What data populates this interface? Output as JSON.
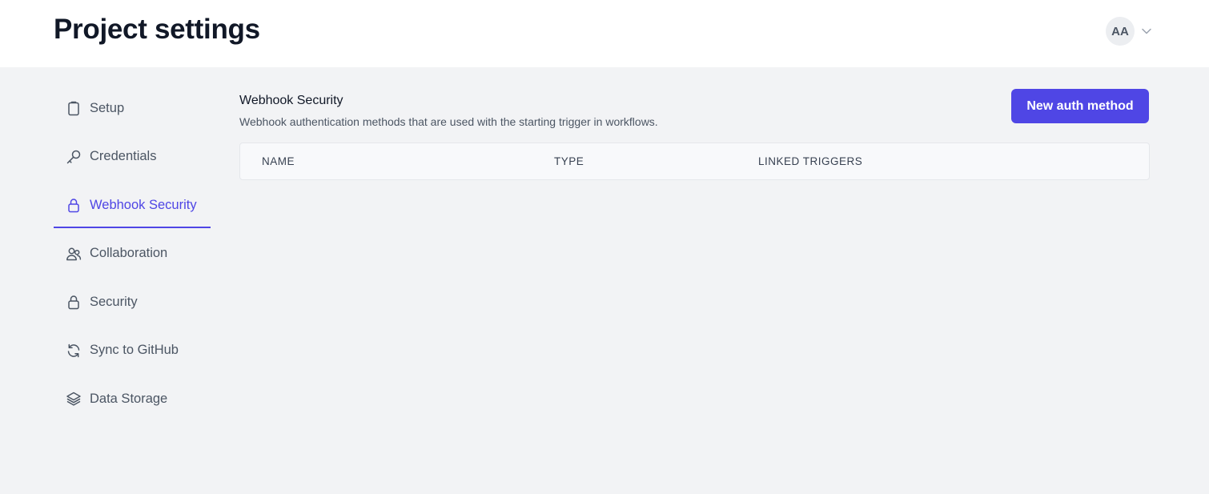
{
  "header": {
    "title": "Project settings",
    "user_initials": "AA",
    "user_menu_icon": "chevron-down-icon"
  },
  "sidebar": {
    "items": [
      {
        "label": "Setup",
        "icon": "clipboard-icon",
        "active": false
      },
      {
        "label": "Credentials",
        "icon": "key-icon",
        "active": false
      },
      {
        "label": "Webhook Security",
        "icon": "lock-icon",
        "active": true
      },
      {
        "label": "Collaboration",
        "icon": "users-icon",
        "active": false
      },
      {
        "label": "Security",
        "icon": "lock-icon",
        "active": false
      },
      {
        "label": "Sync to GitHub",
        "icon": "refresh-icon",
        "active": false
      },
      {
        "label": "Data Storage",
        "icon": "layers-icon",
        "active": false
      }
    ]
  },
  "main": {
    "title": "Webhook Security",
    "description": "Webhook authentication methods that are used with the starting trigger in workflows.",
    "new_button_label": "New auth method",
    "table": {
      "columns": [
        "NAME",
        "TYPE",
        "LINKED TRIGGERS"
      ],
      "rows": []
    }
  },
  "colors": {
    "accent": "#4f46e5",
    "background": "#f2f3f5",
    "header_bg": "#ffffff",
    "text_muted": "#4b5563"
  }
}
